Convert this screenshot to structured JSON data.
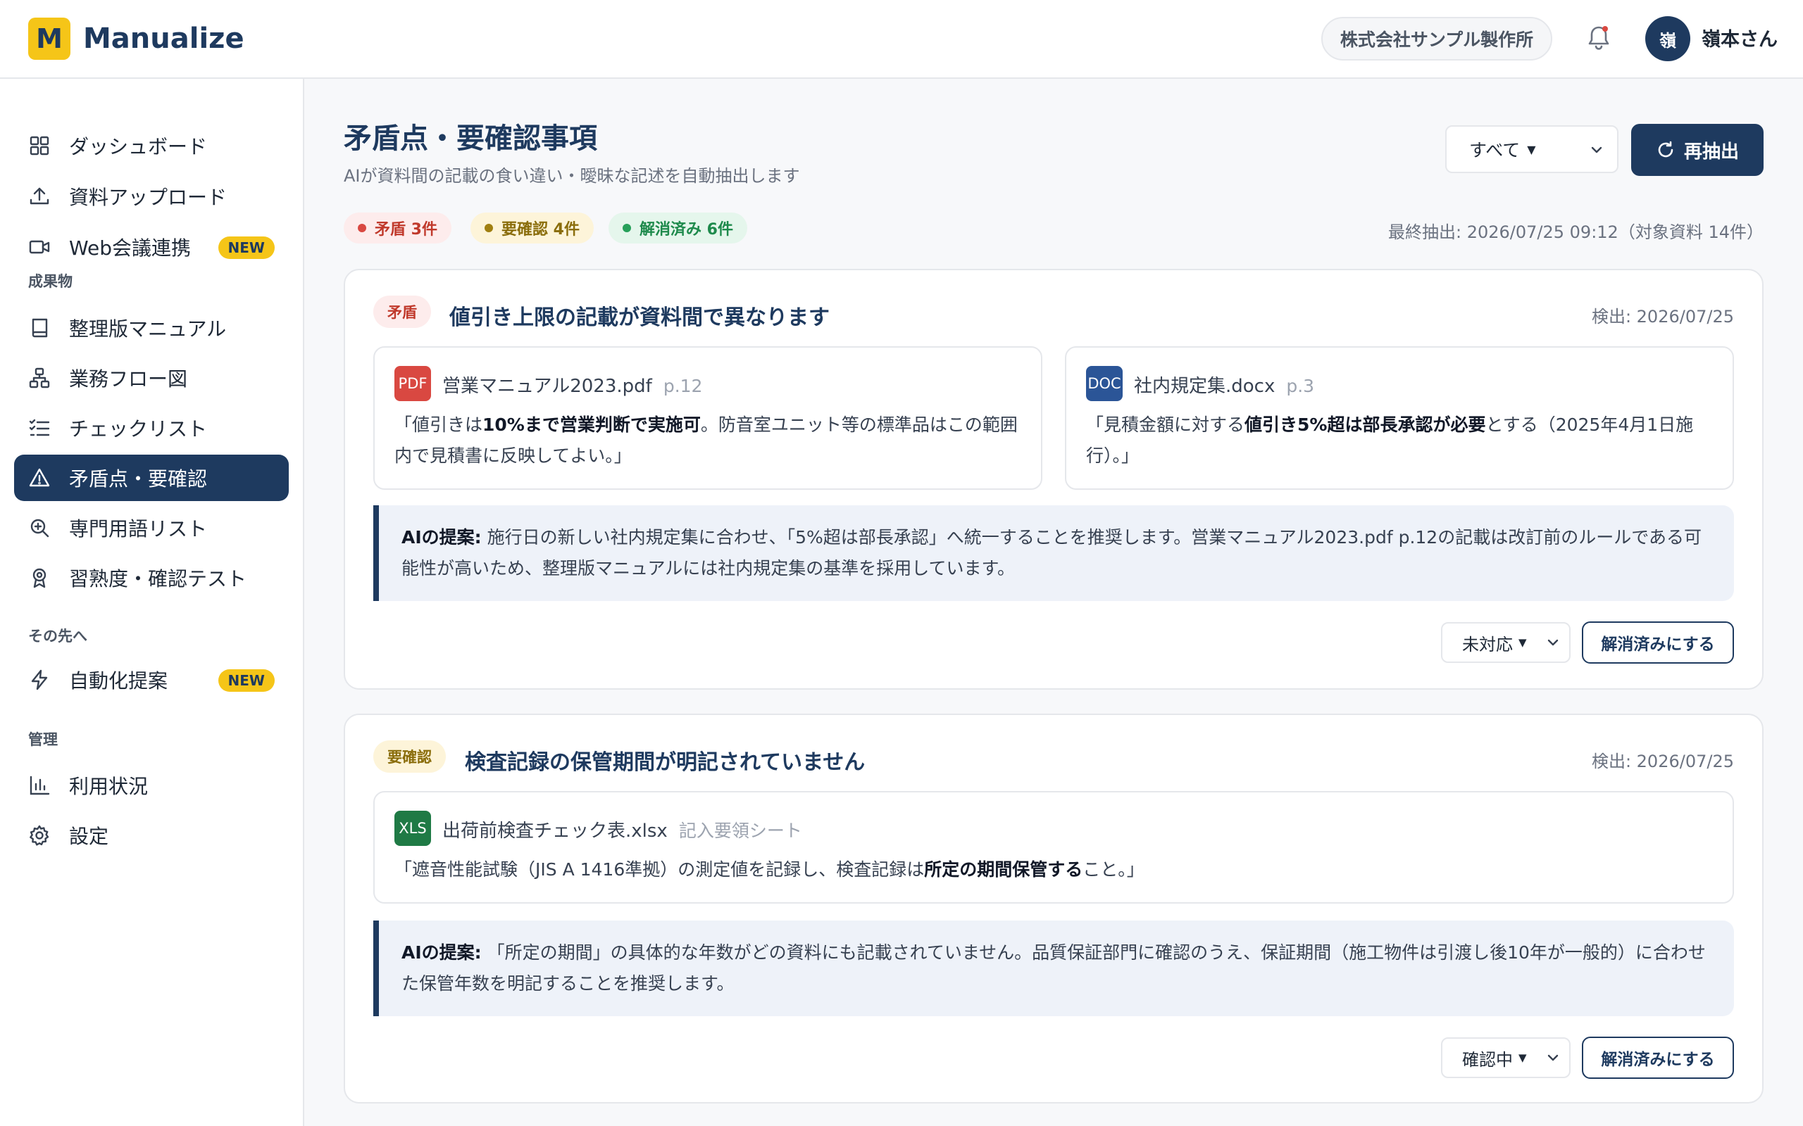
{
  "app": {
    "logo_letter": "M",
    "name": "Manualize"
  },
  "header": {
    "company": "株式会社サンプル製作所",
    "user_initial": "嶺",
    "user_name": "嶺本さん"
  },
  "sidebar": {
    "items": [
      {
        "label": "ダッシュボード",
        "icon": "dashboard-grid-icon"
      },
      {
        "label": "資料アップロード",
        "icon": "upload-icon"
      },
      {
        "label": "Web会議連携",
        "icon": "video-camera-icon",
        "badge": "NEW"
      },
      {
        "label": "整理版マニュアル",
        "icon": "book-icon"
      },
      {
        "label": "業務フロー図",
        "icon": "flow-diagram-icon"
      },
      {
        "label": "チェックリスト",
        "icon": "checklist-icon"
      },
      {
        "label": "矛盾点・要確認",
        "icon": "warning-triangle-icon",
        "active": true
      },
      {
        "label": "専門用語リスト",
        "icon": "search-glossary-icon"
      },
      {
        "label": "習熟度・確認テスト",
        "icon": "award-icon"
      },
      {
        "label": "自動化提案",
        "icon": "lightning-icon",
        "badge": "NEW"
      },
      {
        "label": "利用状況",
        "icon": "bar-chart-icon"
      },
      {
        "label": "設定",
        "icon": "gear-icon"
      }
    ],
    "sections": {
      "outputs": "成果物",
      "beyond": "その先へ",
      "admin": "管理"
    }
  },
  "main": {
    "title": "矛盾点・要確認事項",
    "subtitle": "AIが資料間の記載の食い違い・曖昧な記述を自動抽出します",
    "filter_value": "すべて",
    "reextract_label": "再抽出",
    "pills": {
      "contradiction": "矛盾 3件",
      "check": "要確認 4件",
      "resolved": "解消済み 6件"
    },
    "last_extract": "最終抽出: 2026/07/25 09:12（対象資料 14件）"
  },
  "cards": [
    {
      "tag": "矛盾",
      "title": "値引き上限の記載が資料間で異なります",
      "date": "検出: 2026/07/25",
      "sources": [
        {
          "type": "PDF",
          "name": "営業マニュアル2023.pdf",
          "page": "p.12",
          "quote_pre": "「値引きは",
          "quote_bold": "10%まで営業判断で実施可",
          "quote_post": "。防音室ユニット等の標準品はこの範囲内で見積書に反映してよい。」"
        },
        {
          "type": "DOC",
          "name": "社内規定集.docx",
          "page": "p.3",
          "quote_pre": "「見積金額に対する",
          "quote_bold": "値引き5%超は部長承認が必要",
          "quote_post": "とする（2025年4月1日施行）。」"
        }
      ],
      "ai_label": "AIの提案:",
      "ai_text": "施行日の新しい社内規定集に合わせ、「5%超は部長承認」へ統一することを推奨します。営業マニュアル2023.pdf p.12の記載は改訂前のルールである可能性が高いため、整理版マニュアルには社内規定集の基準を採用しています。",
      "status": "未対応",
      "resolve_label": "解消済みにする"
    },
    {
      "tag": "要確認",
      "title": "検査記録の保管期間が明記されていません",
      "date": "検出: 2026/07/25",
      "sources": [
        {
          "type": "XLS",
          "name": "出荷前検査チェック表.xlsx",
          "page": "記入要領シート",
          "quote_pre": "「遮音性能試験（JIS A 1416準拠）の測定値を記録し、検査記録は",
          "quote_bold": "所定の期間保管する",
          "quote_post": "こと。」"
        }
      ],
      "ai_label": "AIの提案:",
      "ai_text": "「所定の期間」の具体的な年数がどの資料にも記載されていません。品質保証部門に確認のうえ、保証期間（施工物件は引渡し後10年が一般的）に合わせた保管年数を明記することを推奨します。",
      "status": "確認中",
      "resolve_label": "解消済みにする"
    }
  ],
  "colors": {
    "navy": "#1e3a5f",
    "accent_yellow": "#f5c518",
    "red": "#d94841",
    "green": "#27a05a"
  }
}
